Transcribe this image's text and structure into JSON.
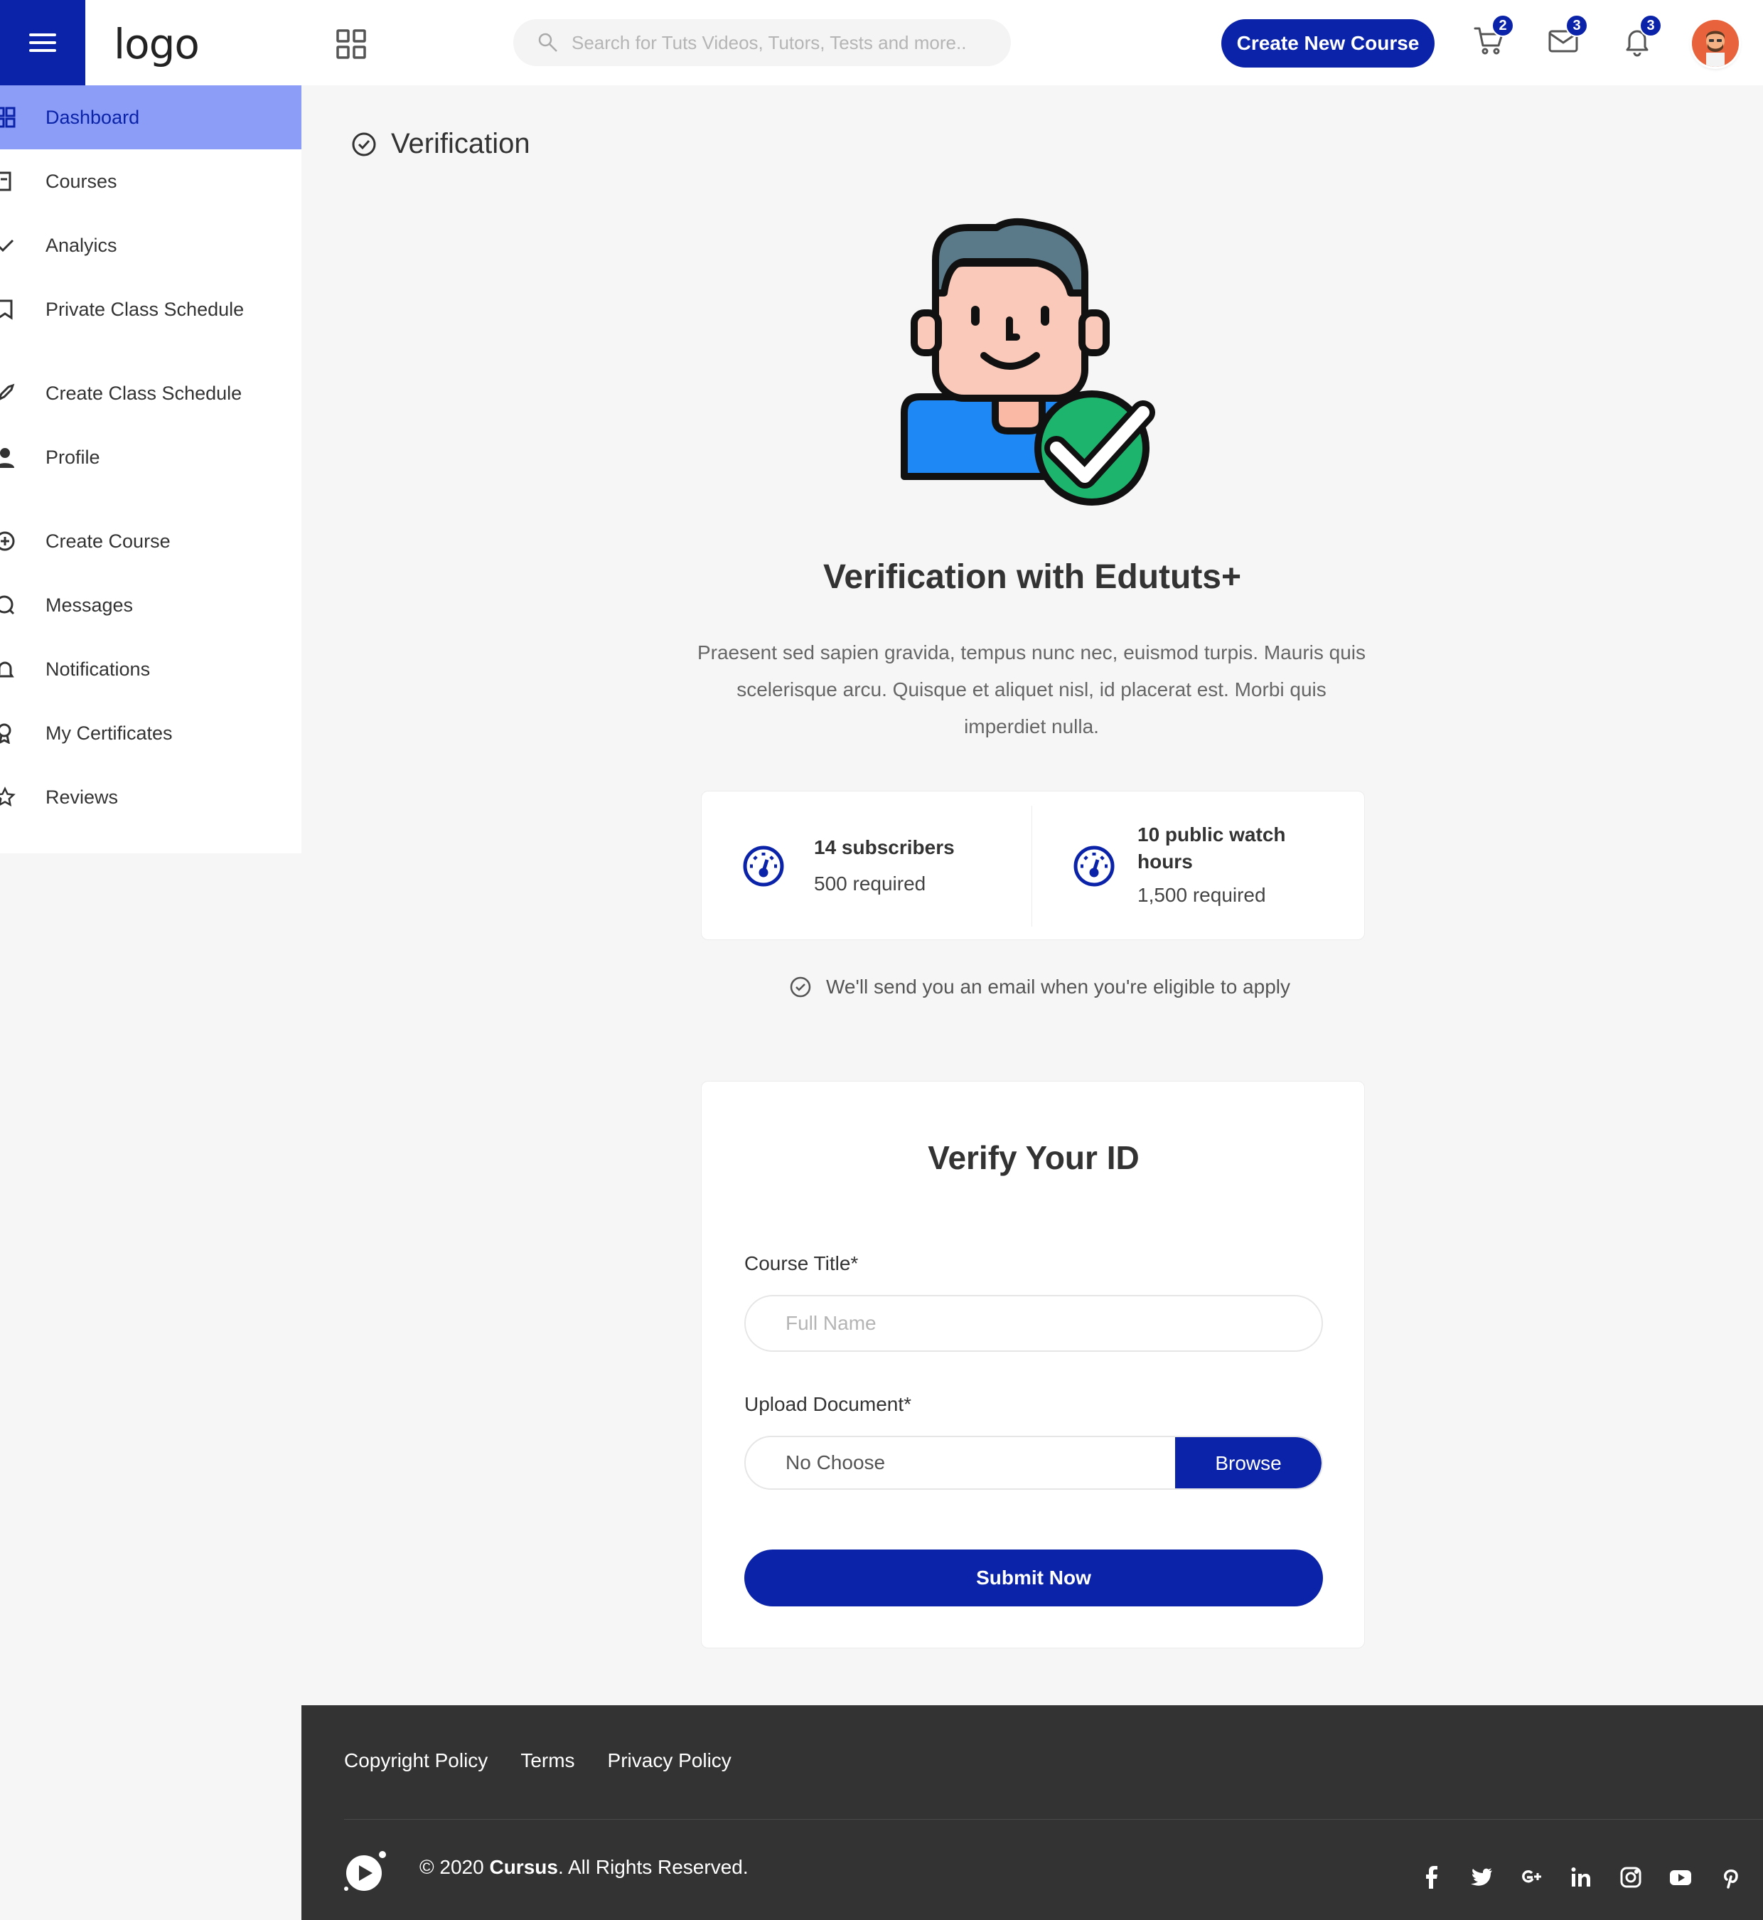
{
  "header": {
    "logo": "logo",
    "search_placeholder": "Search for Tuts Videos, Tutors, Tests and more..",
    "create_button": "Create New Course",
    "cart_count": "2",
    "mail_count": "3",
    "notification_count": "3"
  },
  "sidebar": {
    "items": [
      {
        "label": "Dashboard",
        "icon": "dashboard-icon",
        "active": true
      },
      {
        "label": "Courses",
        "icon": "courses-icon"
      },
      {
        "label": "Analyics",
        "icon": "analytics-icon"
      },
      {
        "label": "Private Class Schedule",
        "icon": "bookmark-icon"
      },
      {
        "label": "Create Class Schedule",
        "icon": "rocket-icon"
      },
      {
        "label": "Profile",
        "icon": "user-icon"
      },
      {
        "label": "Create Course",
        "icon": "plus-circle-icon"
      },
      {
        "label": "Messages",
        "icon": "message-icon"
      },
      {
        "label": "Notifications",
        "icon": "bell-icon"
      },
      {
        "label": "My Certificates",
        "icon": "award-icon"
      },
      {
        "label": "Reviews",
        "icon": "star-icon"
      }
    ]
  },
  "page": {
    "title": "Verification",
    "hero_title": "Verification with Edututs+",
    "hero_description": "Praesent sed sapien gravida, tempus nunc nec, euismod turpis. Mauris quis scelerisque arcu. Quisque et aliquet nisl, id placerat est. Morbi quis imperdiet nulla."
  },
  "stats": [
    {
      "title": "14 subscribers",
      "sub": "500 required"
    },
    {
      "title": "10 public watch hours",
      "sub": "1,500 required"
    }
  ],
  "notice": "We'll send you an email when you're eligible to apply",
  "verify": {
    "title": "Verify Your ID",
    "course_label": "Course Title*",
    "course_placeholder": "Full Name",
    "upload_label": "Upload Document*",
    "file_text": "No Choose",
    "browse": "Browse",
    "submit": "Submit Now"
  },
  "footer": {
    "links": [
      "Copyright Policy",
      "Terms",
      "Privacy Policy"
    ],
    "copyright_prefix": "© 2020 ",
    "copyright_brand": "Cursus",
    "copyright_suffix": ". All Rights Reserved.",
    "socials": [
      "facebook-icon",
      "twitter-icon",
      "google-plus-icon",
      "linkedin-icon",
      "instagram-icon",
      "youtube-icon",
      "pinterest-icon"
    ]
  },
  "colors": {
    "primary": "#0b23a8",
    "sidebar_active": "#8c9df7",
    "footer_bg": "#333333",
    "page_bg": "#f6f6f6"
  }
}
